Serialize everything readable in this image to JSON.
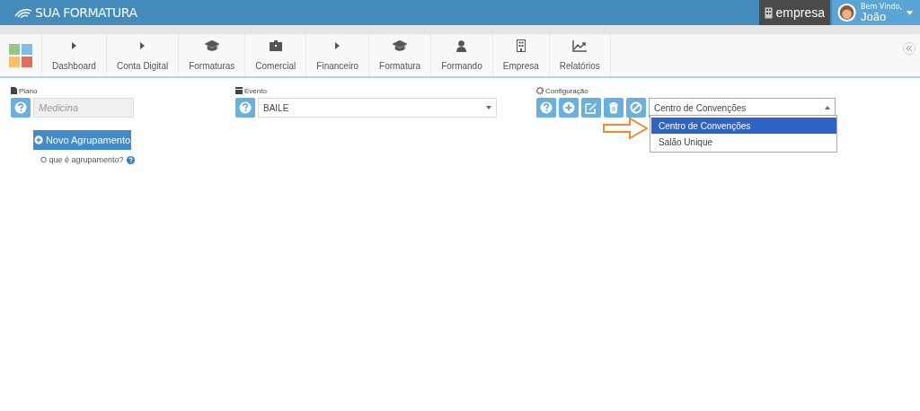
{
  "header": {
    "logo": "SUA FORMATURA",
    "company": "empresa",
    "greeting": "Bem Vindo,",
    "user": "João"
  },
  "nav": [
    {
      "label": "Dashboard"
    },
    {
      "label": "Conta Digital"
    },
    {
      "label": "Formaturas"
    },
    {
      "label": "Comercial"
    },
    {
      "label": "Financeiro"
    },
    {
      "label": "Formatura"
    },
    {
      "label": "Formando"
    },
    {
      "label": "Empresa"
    },
    {
      "label": "Relatórios"
    }
  ],
  "plano": {
    "label": "Plano",
    "placeholder": "Medicina",
    "button": "Novo Agrupamento",
    "help": "O que é agrupamento?"
  },
  "evento": {
    "label": "Evento",
    "value": "BAILE"
  },
  "configuracao": {
    "label": "Configuração",
    "value": "Centro de Convenções",
    "options": [
      {
        "label": "Centro de Convenções",
        "selected": true
      },
      {
        "label": "Salão Unique",
        "selected": false
      }
    ]
  }
}
